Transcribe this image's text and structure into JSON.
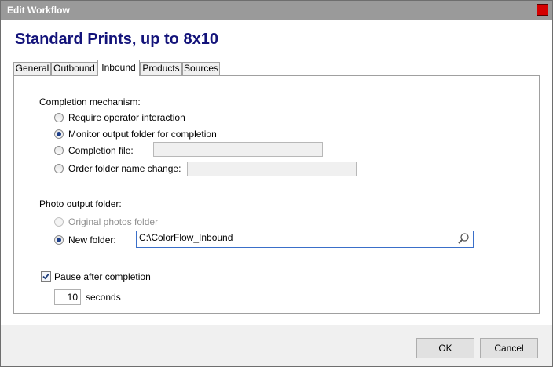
{
  "window": {
    "title": "Edit Workflow"
  },
  "header": {
    "title": "Standard Prints, up to 8x10"
  },
  "tabs": [
    {
      "label": "General",
      "active": false
    },
    {
      "label": "Outbound",
      "active": false
    },
    {
      "label": "Inbound",
      "active": true
    },
    {
      "label": "Products",
      "active": false
    },
    {
      "label": "Sources",
      "active": false
    }
  ],
  "completion": {
    "section_label": "Completion mechanism:",
    "options": [
      {
        "label": "Require operator interaction",
        "selected": false
      },
      {
        "label": "Monitor output folder for completion",
        "selected": true
      },
      {
        "label": "Completion file:",
        "selected": false,
        "value": ""
      },
      {
        "label": "Order folder name change:",
        "selected": false,
        "value": ""
      }
    ]
  },
  "photo_output": {
    "section_label": "Photo output folder:",
    "original_label": "Original photos folder",
    "original_enabled": false,
    "new_folder_label": "New folder:",
    "new_folder_selected": true,
    "new_folder_value": "C:\\ColorFlow_Inbound",
    "browse_icon": "magnifier-icon"
  },
  "pause": {
    "label": "Pause after completion",
    "checked": true,
    "seconds_value": "10",
    "seconds_label": "seconds"
  },
  "footer": {
    "ok_label": "OK",
    "cancel_label": "Cancel"
  },
  "colors": {
    "titlebar": "#9a9a9a",
    "heading": "#13137a",
    "close": "#d40000",
    "focus_border": "#3a6fc9"
  }
}
